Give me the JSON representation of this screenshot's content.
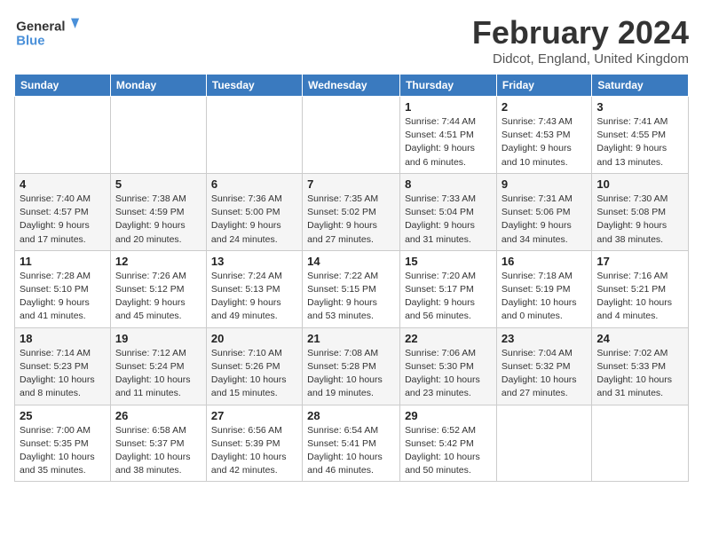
{
  "logo": {
    "line1": "General",
    "line2": "Blue"
  },
  "title": "February 2024",
  "subtitle": "Didcot, England, United Kingdom",
  "days_of_week": [
    "Sunday",
    "Monday",
    "Tuesday",
    "Wednesday",
    "Thursday",
    "Friday",
    "Saturday"
  ],
  "weeks": [
    [
      {
        "day": "",
        "info": ""
      },
      {
        "day": "",
        "info": ""
      },
      {
        "day": "",
        "info": ""
      },
      {
        "day": "",
        "info": ""
      },
      {
        "day": "1",
        "info": "Sunrise: 7:44 AM\nSunset: 4:51 PM\nDaylight: 9 hours\nand 6 minutes."
      },
      {
        "day": "2",
        "info": "Sunrise: 7:43 AM\nSunset: 4:53 PM\nDaylight: 9 hours\nand 10 minutes."
      },
      {
        "day": "3",
        "info": "Sunrise: 7:41 AM\nSunset: 4:55 PM\nDaylight: 9 hours\nand 13 minutes."
      }
    ],
    [
      {
        "day": "4",
        "info": "Sunrise: 7:40 AM\nSunset: 4:57 PM\nDaylight: 9 hours\nand 17 minutes."
      },
      {
        "day": "5",
        "info": "Sunrise: 7:38 AM\nSunset: 4:59 PM\nDaylight: 9 hours\nand 20 minutes."
      },
      {
        "day": "6",
        "info": "Sunrise: 7:36 AM\nSunset: 5:00 PM\nDaylight: 9 hours\nand 24 minutes."
      },
      {
        "day": "7",
        "info": "Sunrise: 7:35 AM\nSunset: 5:02 PM\nDaylight: 9 hours\nand 27 minutes."
      },
      {
        "day": "8",
        "info": "Sunrise: 7:33 AM\nSunset: 5:04 PM\nDaylight: 9 hours\nand 31 minutes."
      },
      {
        "day": "9",
        "info": "Sunrise: 7:31 AM\nSunset: 5:06 PM\nDaylight: 9 hours\nand 34 minutes."
      },
      {
        "day": "10",
        "info": "Sunrise: 7:30 AM\nSunset: 5:08 PM\nDaylight: 9 hours\nand 38 minutes."
      }
    ],
    [
      {
        "day": "11",
        "info": "Sunrise: 7:28 AM\nSunset: 5:10 PM\nDaylight: 9 hours\nand 41 minutes."
      },
      {
        "day": "12",
        "info": "Sunrise: 7:26 AM\nSunset: 5:12 PM\nDaylight: 9 hours\nand 45 minutes."
      },
      {
        "day": "13",
        "info": "Sunrise: 7:24 AM\nSunset: 5:13 PM\nDaylight: 9 hours\nand 49 minutes."
      },
      {
        "day": "14",
        "info": "Sunrise: 7:22 AM\nSunset: 5:15 PM\nDaylight: 9 hours\nand 53 minutes."
      },
      {
        "day": "15",
        "info": "Sunrise: 7:20 AM\nSunset: 5:17 PM\nDaylight: 9 hours\nand 56 minutes."
      },
      {
        "day": "16",
        "info": "Sunrise: 7:18 AM\nSunset: 5:19 PM\nDaylight: 10 hours\nand 0 minutes."
      },
      {
        "day": "17",
        "info": "Sunrise: 7:16 AM\nSunset: 5:21 PM\nDaylight: 10 hours\nand 4 minutes."
      }
    ],
    [
      {
        "day": "18",
        "info": "Sunrise: 7:14 AM\nSunset: 5:23 PM\nDaylight: 10 hours\nand 8 minutes."
      },
      {
        "day": "19",
        "info": "Sunrise: 7:12 AM\nSunset: 5:24 PM\nDaylight: 10 hours\nand 11 minutes."
      },
      {
        "day": "20",
        "info": "Sunrise: 7:10 AM\nSunset: 5:26 PM\nDaylight: 10 hours\nand 15 minutes."
      },
      {
        "day": "21",
        "info": "Sunrise: 7:08 AM\nSunset: 5:28 PM\nDaylight: 10 hours\nand 19 minutes."
      },
      {
        "day": "22",
        "info": "Sunrise: 7:06 AM\nSunset: 5:30 PM\nDaylight: 10 hours\nand 23 minutes."
      },
      {
        "day": "23",
        "info": "Sunrise: 7:04 AM\nSunset: 5:32 PM\nDaylight: 10 hours\nand 27 minutes."
      },
      {
        "day": "24",
        "info": "Sunrise: 7:02 AM\nSunset: 5:33 PM\nDaylight: 10 hours\nand 31 minutes."
      }
    ],
    [
      {
        "day": "25",
        "info": "Sunrise: 7:00 AM\nSunset: 5:35 PM\nDaylight: 10 hours\nand 35 minutes."
      },
      {
        "day": "26",
        "info": "Sunrise: 6:58 AM\nSunset: 5:37 PM\nDaylight: 10 hours\nand 38 minutes."
      },
      {
        "day": "27",
        "info": "Sunrise: 6:56 AM\nSunset: 5:39 PM\nDaylight: 10 hours\nand 42 minutes."
      },
      {
        "day": "28",
        "info": "Sunrise: 6:54 AM\nSunset: 5:41 PM\nDaylight: 10 hours\nand 46 minutes."
      },
      {
        "day": "29",
        "info": "Sunrise: 6:52 AM\nSunset: 5:42 PM\nDaylight: 10 hours\nand 50 minutes."
      },
      {
        "day": "",
        "info": ""
      },
      {
        "day": "",
        "info": ""
      }
    ]
  ]
}
